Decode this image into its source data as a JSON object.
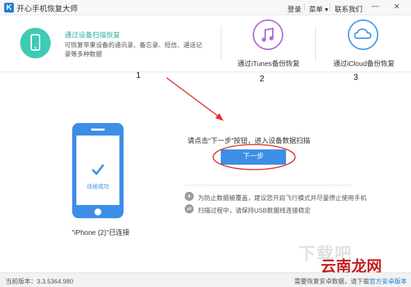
{
  "app": {
    "logo_letter": "K",
    "title": "开心手机恢复大师"
  },
  "titlebar": {
    "login": "登录",
    "menu": "菜单 ▾",
    "contact": "联系我们",
    "minimize": "—",
    "close": "✕"
  },
  "modes": [
    {
      "title": "通过设备扫描恢复",
      "description": "可恢复苹果设备的通讯录、备忘录、短信、通话记录等多种数据",
      "icon": "phone-icon",
      "color": "#3ecbb4",
      "active": true,
      "step": "1"
    },
    {
      "title": "通过iTunes备份恢复",
      "icon": "music-note-icon",
      "color": "#b36ad1",
      "active": false,
      "step": "2"
    },
    {
      "title": "通过iCloud备份恢复",
      "icon": "cloud-icon",
      "color": "#4a9be6",
      "active": false,
      "step": "3"
    }
  ],
  "device": {
    "status": "连接成功",
    "name": "\"iPhone (2)\"已连接"
  },
  "main": {
    "prompt": "请点击“下一步”按钮，进入设备数据扫描",
    "next_button": "下一步"
  },
  "tips": [
    {
      "icon": "airplane-icon",
      "text": "为防止数据被覆盖，建议您开启飞行模式并尽量停止使用手机"
    },
    {
      "icon": "usb-icon",
      "text": "扫描过程中，请保持USB数据线连接稳定"
    }
  ],
  "footer": {
    "version": "当前版本：3.3.5364.980",
    "right_text": "需要恢复安卓数据，请下载",
    "right_link": "官方安卓版本"
  },
  "watermark": {
    "text_gray": "下载吧",
    "text_red": "云南龙网"
  },
  "colors": {
    "accent": "#3d8ee6",
    "active_mode": "#2eb19a",
    "annotation_red": "#e03030"
  }
}
